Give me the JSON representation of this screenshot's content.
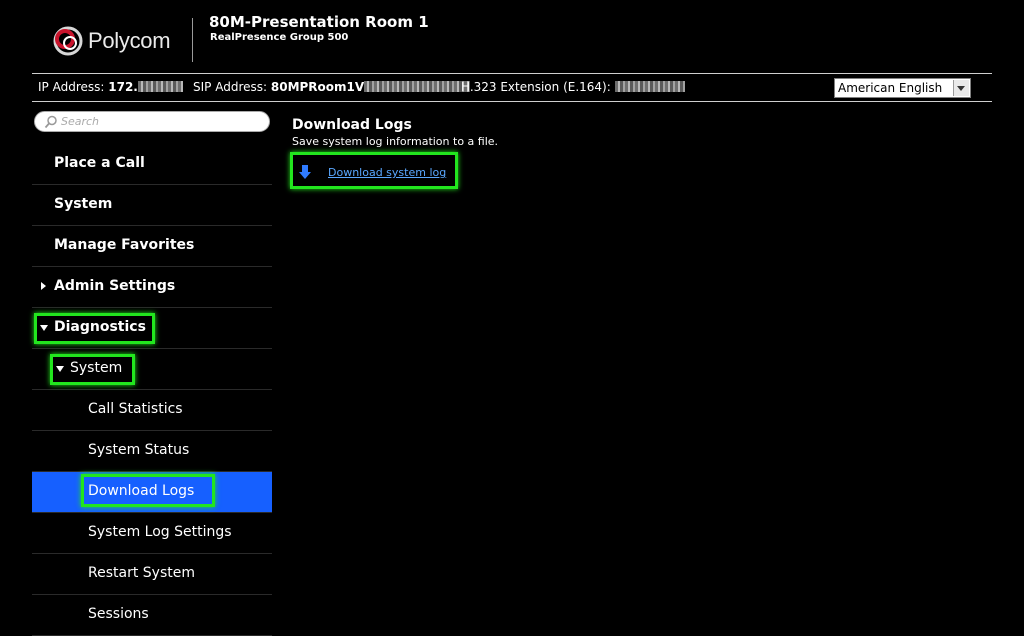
{
  "brand": {
    "logo_text": "Polycom"
  },
  "header": {
    "room_title": "80M-Presentation Room 1",
    "room_subtitle": "RealPresence Group 500"
  },
  "infobar": {
    "ip_label": "IP Address:",
    "ip_value": "172.",
    "sip_label": "SIP Address:",
    "sip_value": "80MPRoom1V",
    "h323_label": "H.323 Extension (E.164):"
  },
  "language": {
    "selected": "American English"
  },
  "search": {
    "placeholder": "Search"
  },
  "sidebar": {
    "items": [
      {
        "label": "Place a Call"
      },
      {
        "label": "System"
      },
      {
        "label": "Manage Favorites"
      },
      {
        "label": "Admin Settings"
      },
      {
        "label": "Diagnostics"
      },
      {
        "label": "System"
      },
      {
        "label": "Call Statistics"
      },
      {
        "label": "System Status"
      },
      {
        "label": "Download Logs"
      },
      {
        "label": "System Log Settings"
      },
      {
        "label": "Restart System"
      },
      {
        "label": "Sessions"
      }
    ]
  },
  "content": {
    "title": "Download Logs",
    "description": "Save system log information to a file.",
    "link_label": "Download system log"
  },
  "colors": {
    "active_item": "#1660ff",
    "highlight": "#22e61e",
    "link": "#5aa8ff"
  }
}
